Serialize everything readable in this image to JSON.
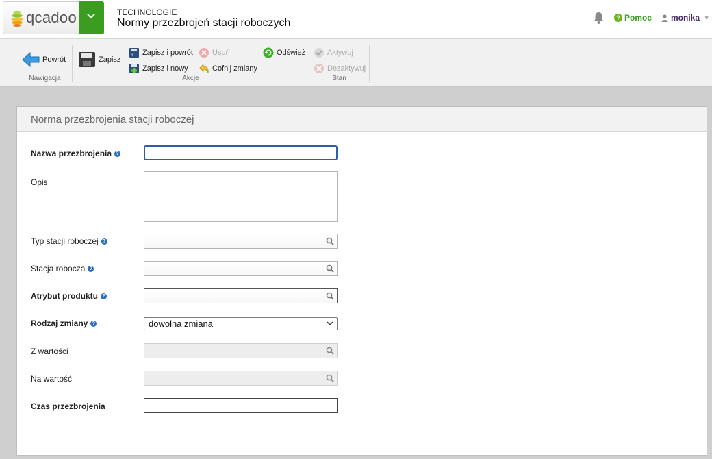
{
  "header": {
    "logo_text": "qcadoo",
    "module": "TECHNOLOGIE",
    "title": "Normy przezbrojeń stacji roboczych",
    "help_label": "Pomoc",
    "user_name": "monika"
  },
  "ribbon": {
    "back_label": "Powrót",
    "save_label": "Zapisz",
    "save_back_label": "Zapisz i powrót",
    "save_new_label": "Zapisz i nowy",
    "delete_label": "Usuń",
    "undo_label": "Cofnij zmiany",
    "refresh_label": "Odśwież",
    "activate_label": "Aktywuj",
    "deactivate_label": "Dezaktywuj",
    "group_nav": "Nawigacja",
    "group_actions": "Akcje",
    "group_state": "Stan"
  },
  "form": {
    "title": "Norma przezbrojenia stacji roboczej",
    "name_label": "Nazwa przezbrojenia",
    "name_value": "",
    "desc_label": "Opis",
    "desc_value": "",
    "ws_type_label": "Typ stacji roboczej",
    "ws_type_value": "",
    "ws_label": "Stacja robocza",
    "ws_value": "",
    "attr_label": "Atrybut produktu",
    "attr_value": "",
    "change_type_label": "Rodzaj zmiany",
    "change_type_value": "dowolna zmiana",
    "from_label": "Z wartości",
    "from_value": "",
    "to_label": "Na wartość",
    "to_value": "",
    "time_label": "Czas przezbrojenia",
    "time_value": ""
  },
  "icons": {
    "bell": "bell-icon",
    "help": "help-icon",
    "user": "user-icon",
    "lookup": "magnifier-icon",
    "info": "info-icon"
  },
  "colors": {
    "brand_green": "#3a9d1f",
    "focus_blue": "#2a5fab",
    "info_blue": "#2a6ec0"
  }
}
